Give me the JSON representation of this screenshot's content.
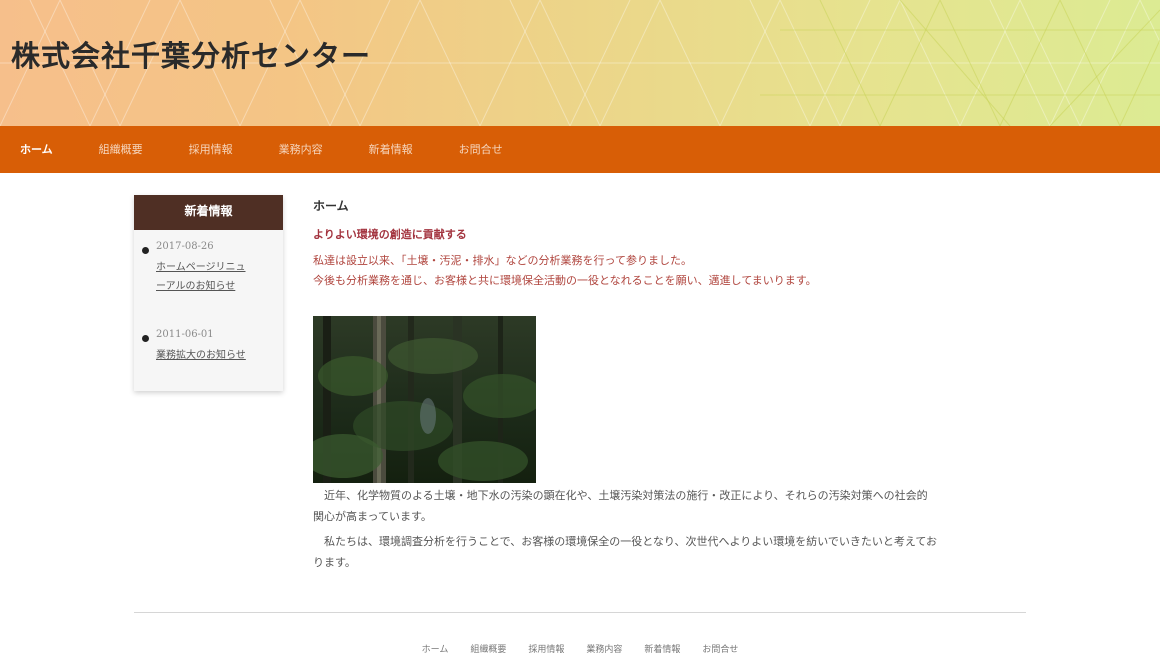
{
  "header": {
    "site_title": "株式会社千葉分析センター"
  },
  "nav": {
    "items": [
      "ホーム",
      "組織概要",
      "採用情報",
      "業務内容",
      "新着情報",
      "お問合せ"
    ],
    "active": "ホーム",
    "bg_color": "#d85e06"
  },
  "sidebar": {
    "title": "新着情報",
    "news": [
      {
        "date": "2017-08-26",
        "title": "ホームページリニューアルのお知らせ"
      },
      {
        "date": "2011-06-01",
        "title": "業務拡大のお知らせ"
      }
    ]
  },
  "main": {
    "breadcrumb": "ホーム",
    "lead": "よりよい環境の創造に貢献する",
    "intro_line1": "私達は設立以来、「土壌・汚泥・排水」などの分析業務を行って参りました。",
    "intro_line2": "今後も分析業務を通じ、お客様と共に環境保全活動の一役となれることを願い、邁進してまいります。",
    "paragraph1": "近年、化学物質のよる土壌・地下水の汚染の顕在化や、土壌汚染対策法の施行・改正により、それらの汚染対策への社会的関心が高まっています。",
    "paragraph2": "私たちは、環境調査分析を行うことで、お客様の環境保全の一役となり、次世代へよりよい環境を紡いでいきたいと考えております。"
  },
  "footer": {
    "items": [
      "ホーム",
      "組織概要",
      "採用情報",
      "業務内容",
      "新着情報",
      "お問合せ"
    ]
  }
}
